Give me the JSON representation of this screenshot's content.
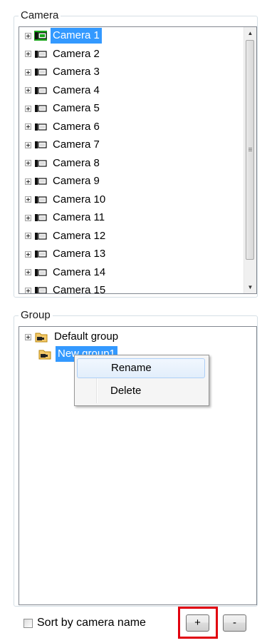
{
  "camera_panel": {
    "title": "Camera",
    "cameras": [
      "Camera 1",
      "Camera 2",
      "Camera 3",
      "Camera 4",
      "Camera 5",
      "Camera 6",
      "Camera 7",
      "Camera 8",
      "Camera 9",
      "Camera 10",
      "Camera 11",
      "Camera 12",
      "Camera 13",
      "Camera 14",
      "Camera 15"
    ],
    "selected_index": 0
  },
  "group_panel": {
    "title": "Group",
    "groups": [
      "Default group",
      "New group1"
    ],
    "selected_index": 1
  },
  "context_menu": {
    "items": [
      "Rename",
      "Delete"
    ],
    "hover_index": 0
  },
  "footer": {
    "sort_label": "Sort by camera name",
    "sort_checked": false,
    "add_label": "+",
    "remove_label": "-"
  },
  "colors": {
    "selection": "#3399ff",
    "highlight_box": "#e1000f"
  }
}
